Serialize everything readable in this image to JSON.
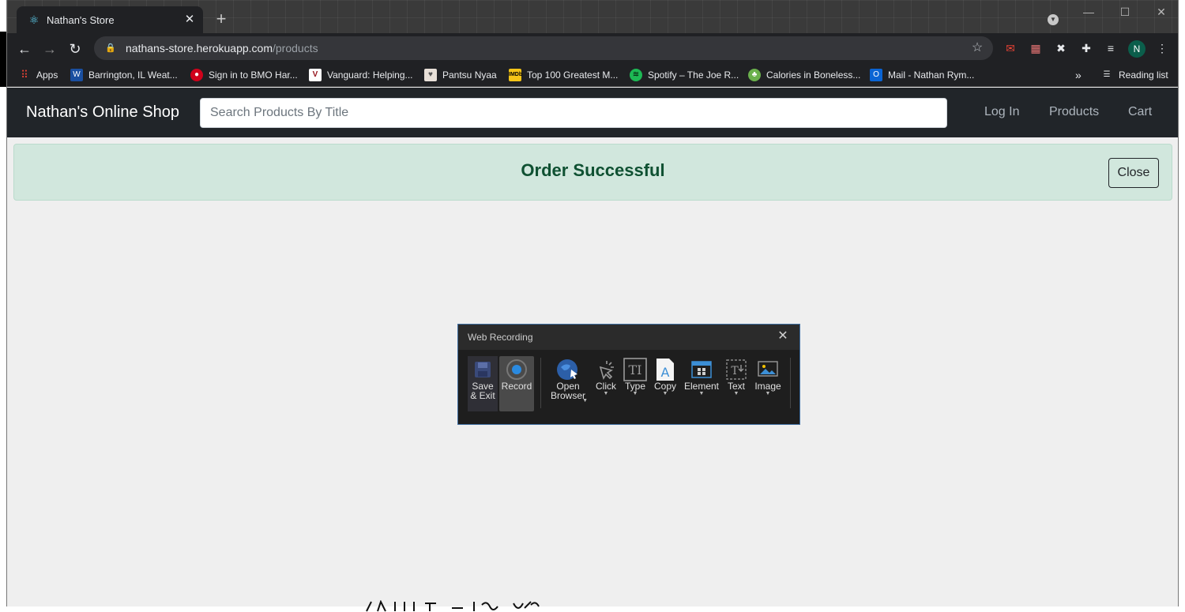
{
  "browser": {
    "tab": {
      "title": "Nathan's Store"
    },
    "url": {
      "host": "nathans-store.herokuapp.com",
      "path": "/products"
    },
    "profile_initial": "N",
    "bookmarks": [
      {
        "label": "Apps"
      },
      {
        "label": "Barrington, IL Weat..."
      },
      {
        "label": "Sign in to BMO Har..."
      },
      {
        "label": "Vanguard: Helping..."
      },
      {
        "label": "Pantsu Nyaa"
      },
      {
        "label": "Top 100 Greatest M..."
      },
      {
        "label": "Spotify – The Joe R..."
      },
      {
        "label": "Calories in Boneless..."
      },
      {
        "label": "Mail - Nathan Rym..."
      }
    ],
    "bookmarks_overflow": "»",
    "reading_list": "Reading list"
  },
  "page": {
    "brand": "Nathan's Online Shop",
    "search_placeholder": "Search Products By Title",
    "nav": {
      "login": "Log In",
      "products": "Products",
      "cart": "Cart"
    },
    "alert": {
      "message": "Order Successful",
      "close_label": "Close"
    }
  },
  "recorder": {
    "title": "Web Recording",
    "tools": [
      {
        "label": "Save\n& Exit"
      },
      {
        "label": "Record"
      },
      {
        "label": "Open\nBrowser"
      },
      {
        "label": "Click"
      },
      {
        "label": "Type"
      },
      {
        "label": "Copy"
      },
      {
        "label": "Element"
      },
      {
        "label": "Text"
      },
      {
        "label": "Image"
      }
    ]
  },
  "colors": {
    "navbar": "#212529",
    "alert_bg": "#d1e7dd",
    "alert_text": "#0f5132",
    "recorder_accent": "#3f6ea1"
  }
}
